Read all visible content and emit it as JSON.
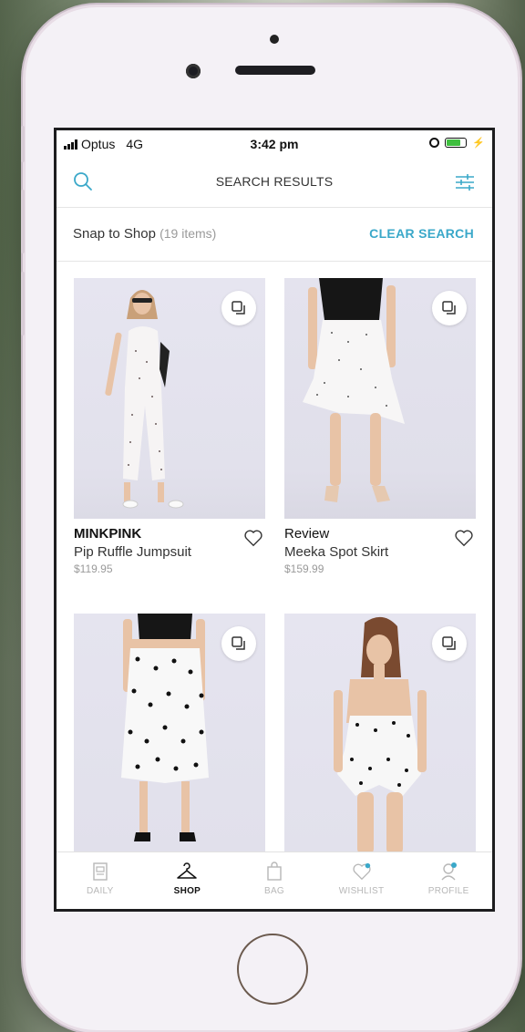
{
  "status": {
    "carrier": "Optus",
    "network": "4G",
    "time": "3:42 pm"
  },
  "header": {
    "title": "SEARCH RESULTS"
  },
  "subbar": {
    "label": "Snap to Shop",
    "count": "(19 items)",
    "clear": "CLEAR SEARCH"
  },
  "products": [
    {
      "brand": "MINKPINK",
      "name": "Pip Ruffle Jumpsuit",
      "price": "$119.95"
    },
    {
      "brand": "Review",
      "name": "Meeka Spot Skirt",
      "price": "$159.99"
    },
    {
      "brand": "",
      "name": "",
      "price": ""
    },
    {
      "brand": "",
      "name": "",
      "price": ""
    }
  ],
  "tabs": [
    {
      "label": "DAILY",
      "icon": "daily-icon"
    },
    {
      "label": "SHOP",
      "icon": "hanger-icon"
    },
    {
      "label": "BAG",
      "icon": "bag-icon"
    },
    {
      "label": "WISHLIST",
      "icon": "heart-icon"
    },
    {
      "label": "PROFILE",
      "icon": "profile-icon"
    }
  ],
  "colors": {
    "accent": "#3aa8c9",
    "active_tab": "#111111",
    "inactive_tab": "#b7b7b7"
  }
}
